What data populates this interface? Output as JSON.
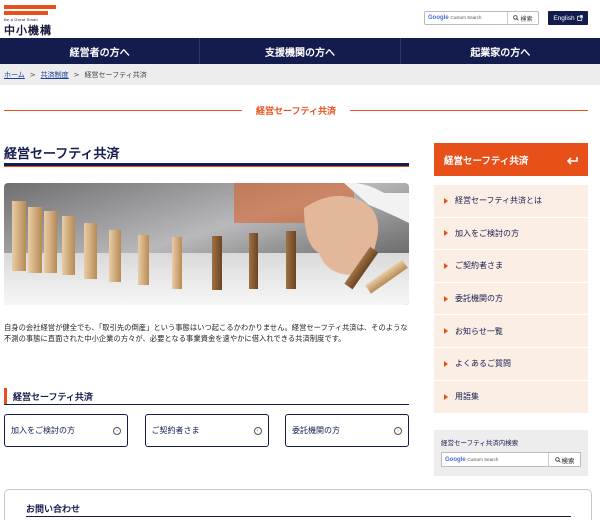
{
  "header": {
    "logo_tagline": "Be a Great Small",
    "logo_name": "中小機構",
    "search_placeholder": "Custom Search",
    "search_google": "Google",
    "search_button": "検索",
    "english_label": "English"
  },
  "nav": {
    "items": [
      "経営者の方へ",
      "支援機関の方へ",
      "起業家の方へ"
    ]
  },
  "breadcrumb": {
    "home": "ホーム",
    "sep": ">",
    "parent": "共済制度",
    "current": "経営セーフティ共済"
  },
  "section_title": "経営セーフティ共済",
  "main": {
    "title": "経営セーフティ共済",
    "description": "自身の会社経営が健全でも、「取引先の倒産」という事態はいつ起こるかわかりません。経営セーフティ共済は、そのような不測の事態に直面された中小企業の方々が、必要となる事業資金を速やかに借入れできる共済制度です。",
    "sub_title": "経営セーフティ共済",
    "cards": [
      "加入をご検討の方",
      "ご契約者さま",
      "委託機関の方"
    ],
    "contact_title": "お問い合わせ"
  },
  "sidebar": {
    "head": "経営セーフティ共済",
    "items": [
      "経営セーフティ共済とは",
      "加入をご検討の方",
      "ご契約者さま",
      "委託機関の方",
      "お知らせ一覧",
      "よくあるご質問",
      "用語集"
    ],
    "search_label": "経営セーフティ共済内検索",
    "search_placeholder": "Custom Search",
    "search_google": "Google",
    "search_button": "検索"
  },
  "colors": {
    "brand_navy": "#141b4d",
    "accent_orange": "#e8501a",
    "sidebar_bg": "#fbeee4"
  }
}
